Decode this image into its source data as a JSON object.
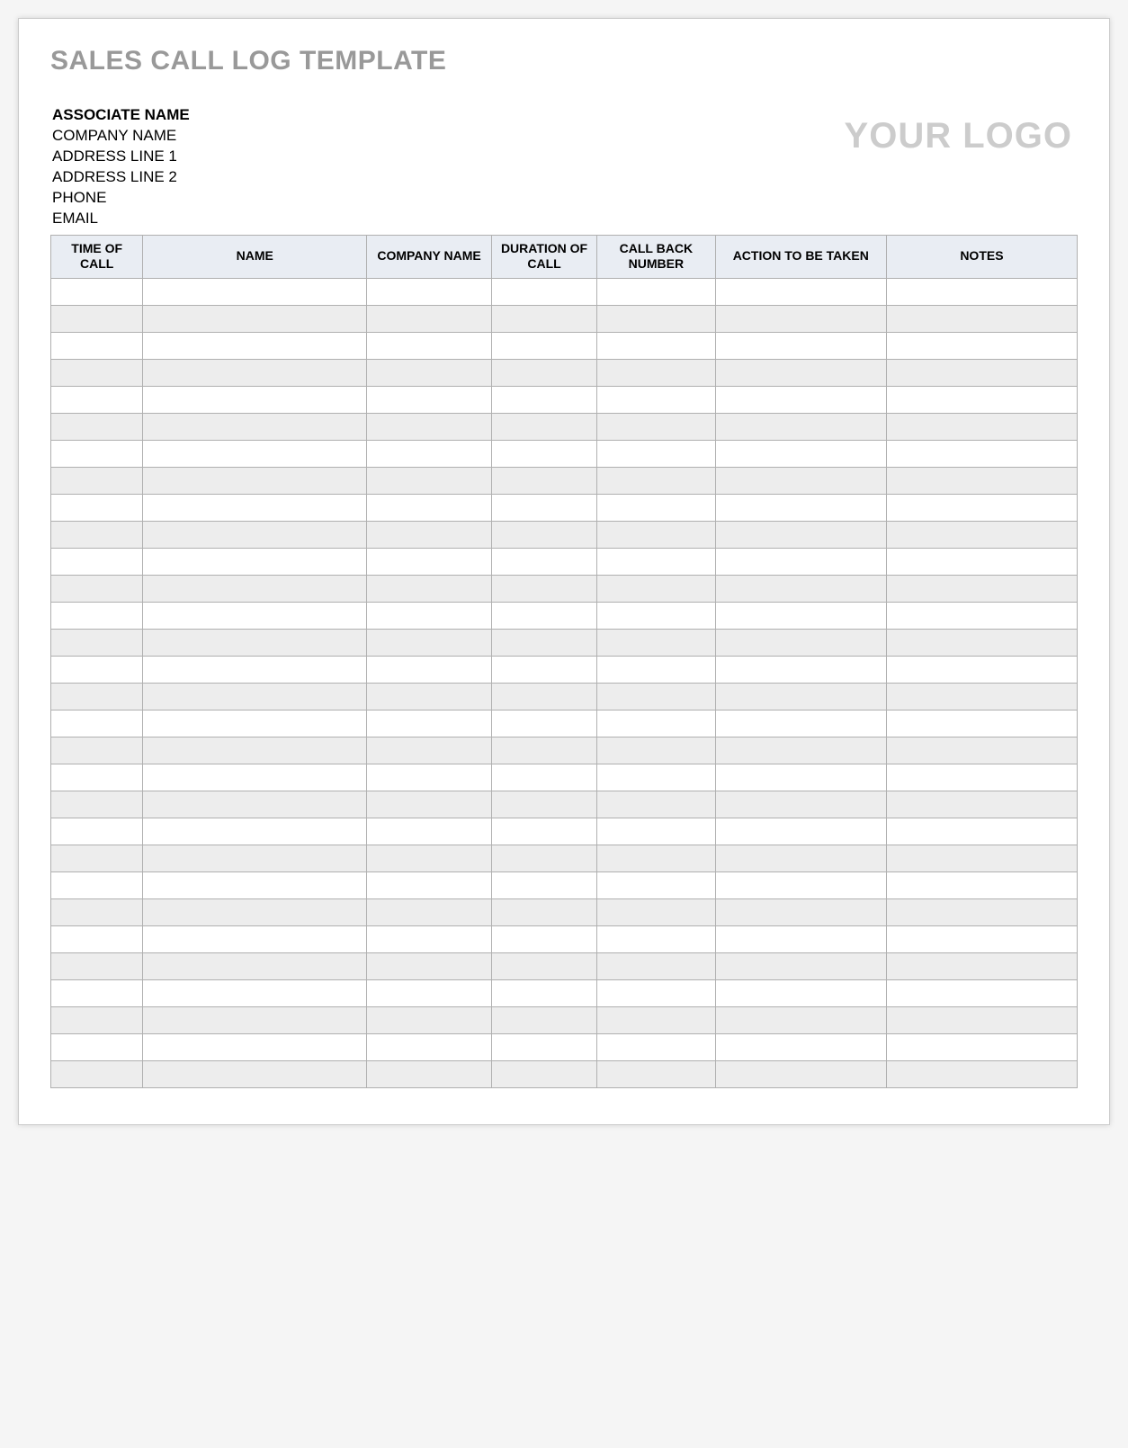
{
  "title": "SALES CALL LOG TEMPLATE",
  "associate": {
    "name_label": "ASSOCIATE NAME",
    "company_label": "COMPANY NAME",
    "address1_label": "ADDRESS LINE 1",
    "address2_label": "ADDRESS LINE 2",
    "phone_label": "PHONE",
    "email_label": "EMAIL"
  },
  "logo_text": "YOUR LOGO",
  "table": {
    "headers": {
      "time": "TIME OF CALL",
      "name": "NAME",
      "company": "COMPANY NAME",
      "duration": "DURATION OF CALL",
      "callback": "CALL BACK NUMBER",
      "action": "ACTION TO BE TAKEN",
      "notes": "NOTES"
    },
    "row_count": 30
  }
}
